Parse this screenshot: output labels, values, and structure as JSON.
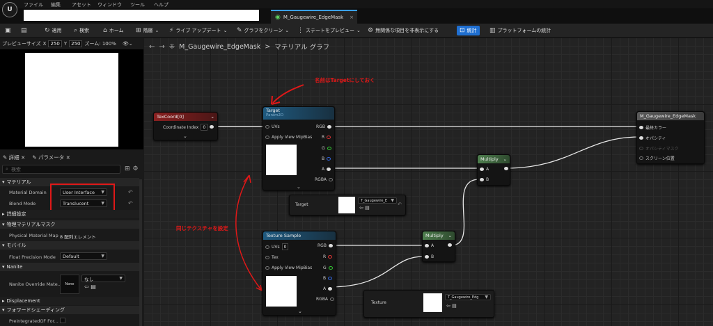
{
  "menu": {
    "items": [
      "ファイル",
      "編集",
      "アセット",
      "ウィンドウ",
      "ツール",
      "ヘルプ"
    ]
  },
  "tab": {
    "title": "M_Gaugewire_EdgeMask",
    "close": "×"
  },
  "toolbar": {
    "save": "💾",
    "browse": "📁",
    "apply": "適用",
    "search": "検索",
    "home": "ホーム",
    "hierarchy": "階層",
    "live_update": "ライブ アップデート",
    "clean_graph": "グラフをクリーン",
    "preview_state": "ステートをプレビュー",
    "hide_unrelated": "無関係な項目を非表示にする",
    "stats": "統計",
    "platform_stats": "プラットフォームの統計"
  },
  "preview": {
    "size_label": "プレビューサイズ",
    "x_label": "X",
    "x_value": "250",
    "y_label": "Y",
    "y_value": "250",
    "zoom_label": "ズーム: 100%"
  },
  "panel": {
    "details_tab": "詳細",
    "params_tab": "パラメータ",
    "search_placeholder": "検索"
  },
  "sections": {
    "material": "マテリアル",
    "advanced": "詳細設定",
    "physical_mask": "物理マテリアルマスク",
    "mobile": "モバイル",
    "nanite": "Nanite",
    "displacement": "Displacement",
    "forward_shading": "フォワードシェーディング"
  },
  "props": {
    "material_domain": {
      "label": "Material Domain",
      "value": "User Interface"
    },
    "blend_mode": {
      "label": "Blend Mode",
      "value": "Translucent"
    },
    "physical_material_map": {
      "label": "Physical Material Map",
      "value": "8 配列エレメント"
    },
    "float_precision": {
      "label": "Float Precision Mode",
      "value": "Default"
    },
    "nanite_override": {
      "label": "Nanite Override Mate...",
      "value": "なし",
      "thumb": "None"
    },
    "preintegrated": {
      "label": "PreintegratedGF For..."
    }
  },
  "graph": {
    "breadcrumb_asset": "M_Gaugewire_EdgeMask",
    "breadcrumb_sep": ">",
    "breadcrumb_graph": "マテリアル グラフ"
  },
  "nodes": {
    "texcoord": {
      "title": "TexCoord[0]",
      "pin": "Coordinate Index",
      "value": "0"
    },
    "target": {
      "title": "Target",
      "subtitle": "Param2D",
      "uvs": "UVs",
      "mip": "Apply View MipBias",
      "rgb": "RGB",
      "r": "R",
      "g": "G",
      "b": "B",
      "a": "A",
      "rgba": "RGBA"
    },
    "target_param": {
      "label": "Target",
      "asset": "T_Gaugewire_E"
    },
    "texsample": {
      "title": "Texture Sample",
      "uvs": "UVs",
      "uvs_value": "0",
      "tex": "Tex",
      "mip": "Apply View MipBias",
      "rgb": "RGB",
      "r": "R",
      "g": "G",
      "b": "B",
      "a": "A",
      "rgba": "RGBA"
    },
    "texsample_param": {
      "label": "Texture",
      "asset": "T_Gaugewire_Edg"
    },
    "multiply1": {
      "title": "Multiply",
      "a": "A",
      "b": "B"
    },
    "multiply2": {
      "title": "Multiply",
      "a": "A",
      "b": "B"
    },
    "output": {
      "title": "M_Gaugewire_EdgeMask",
      "final_color": "最終カラー",
      "opacity": "オパシティ",
      "opacity_mask": "オパシティマスク",
      "screen_pos": "スクリーン位置"
    }
  },
  "annotations": {
    "rename": "名前はTargetにしておく",
    "same_texture": "同じテクスチャを設定"
  },
  "colors": {
    "accent": "#1f6fd1",
    "annotation": "#e01818",
    "texcoord_header": "#8a2020",
    "param_header": "#1f5a80",
    "multiply_header": "#3e6e3e",
    "output_header": "#5a5a5a"
  }
}
